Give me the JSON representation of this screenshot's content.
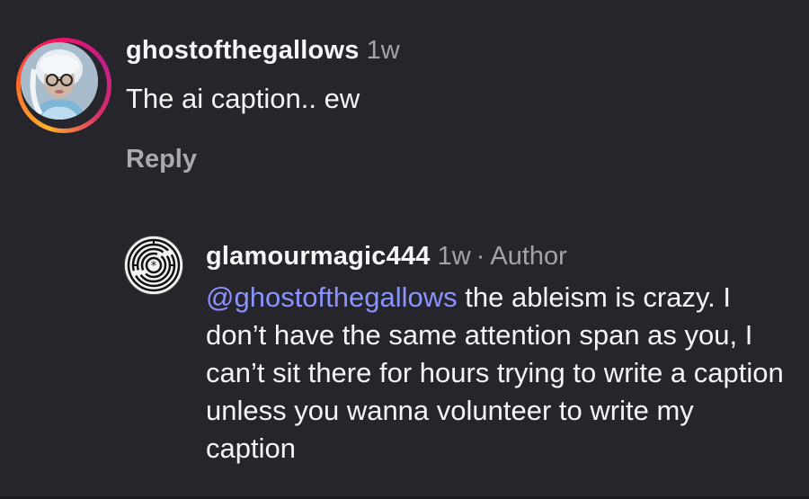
{
  "comments": [
    {
      "username": "ghostofthegallows",
      "time": "1w",
      "text": "The ai caption.. ew",
      "reply_label": "Reply",
      "avatar_icon": "profile-photo-icon"
    }
  ],
  "reply": {
    "username": "glamourmagic444",
    "time": "1w",
    "separator": "·",
    "badge": "Author",
    "mention": "@ghostofthegallows",
    "text": " the ableism is crazy. I don’t have the same attention span as you, I can’t sit there for hours trying to write a caption unless you wanna volunteer to write my caption",
    "avatar_icon": "labyrinth-icon"
  },
  "colors": {
    "background": "#25252b",
    "mention": "#8b93ff",
    "secondary_text": "#a3a3ab",
    "story_ring": [
      "#ffb02e",
      "#f5135c",
      "#c21d8a"
    ]
  }
}
